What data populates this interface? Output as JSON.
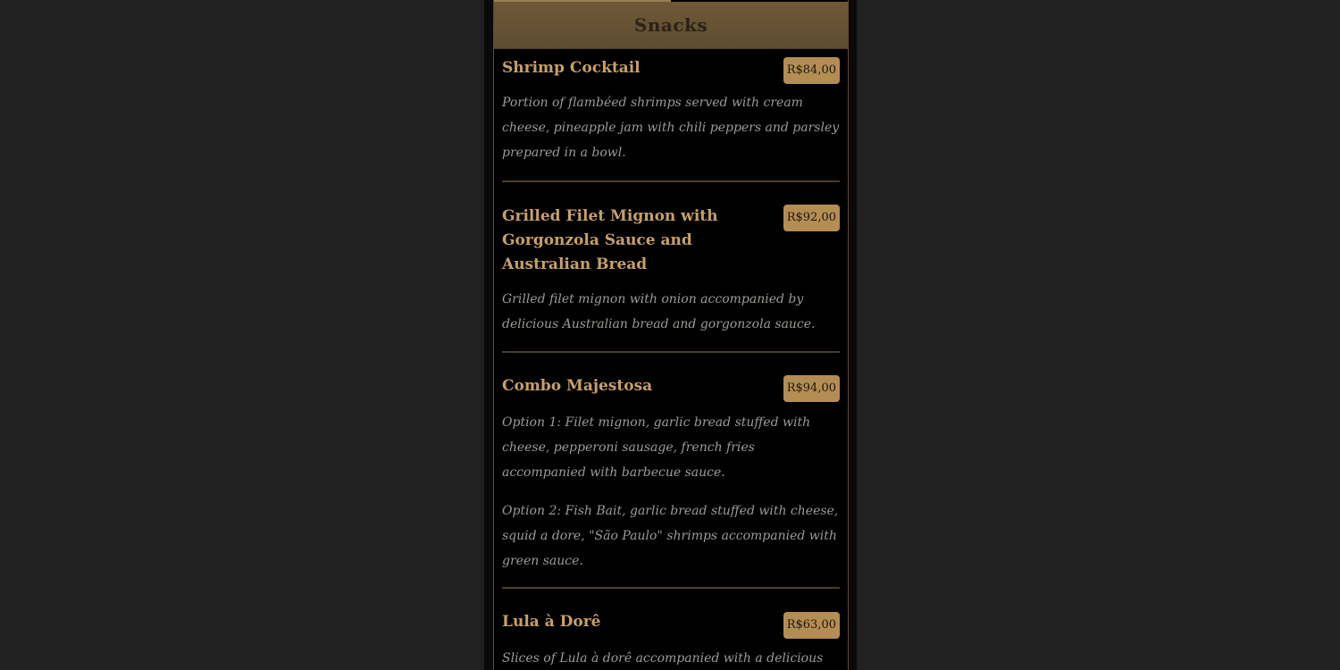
{
  "section": {
    "title": "Snacks"
  },
  "items": [
    {
      "name": "Shrimp Cocktail",
      "price": "R$84,00",
      "description": [
        "Portion of flambéed shrimps served with cream cheese, pineapple jam with chili peppers and parsley prepared in a bowl."
      ]
    },
    {
      "name": "Grilled Filet Mignon with Gorgonzola Sauce and Australian Bread",
      "price": "R$92,00",
      "description": [
        "Grilled filet mignon with onion accompanied by delicious Australian bread and gorgonzola sauce."
      ]
    },
    {
      "name": "Combo Majestosa",
      "price": "R$94,00",
      "description": [
        "Option 1: Filet mignon, garlic bread stuffed with cheese, pepperoni sausage, french fries accompanied with barbecue sauce.",
        "Option 2: Fish Bait, garlic bread stuffed with cheese, squid a dore, \"São Paulo\" shrimps accompanied with green sauce."
      ]
    },
    {
      "name": "Lula à Dorê",
      "price": "R$63,00",
      "description": [
        "Slices of Lula à dorê accompanied with a delicious"
      ]
    }
  ],
  "colors": {
    "page_background": "#212121",
    "panel_background": "#000000",
    "header_background": "#6e5837",
    "title_gold": "#c7a066",
    "price_badge": "#b48d55",
    "description_gray": "#9c9a96",
    "divider": "#4a3e2e"
  }
}
